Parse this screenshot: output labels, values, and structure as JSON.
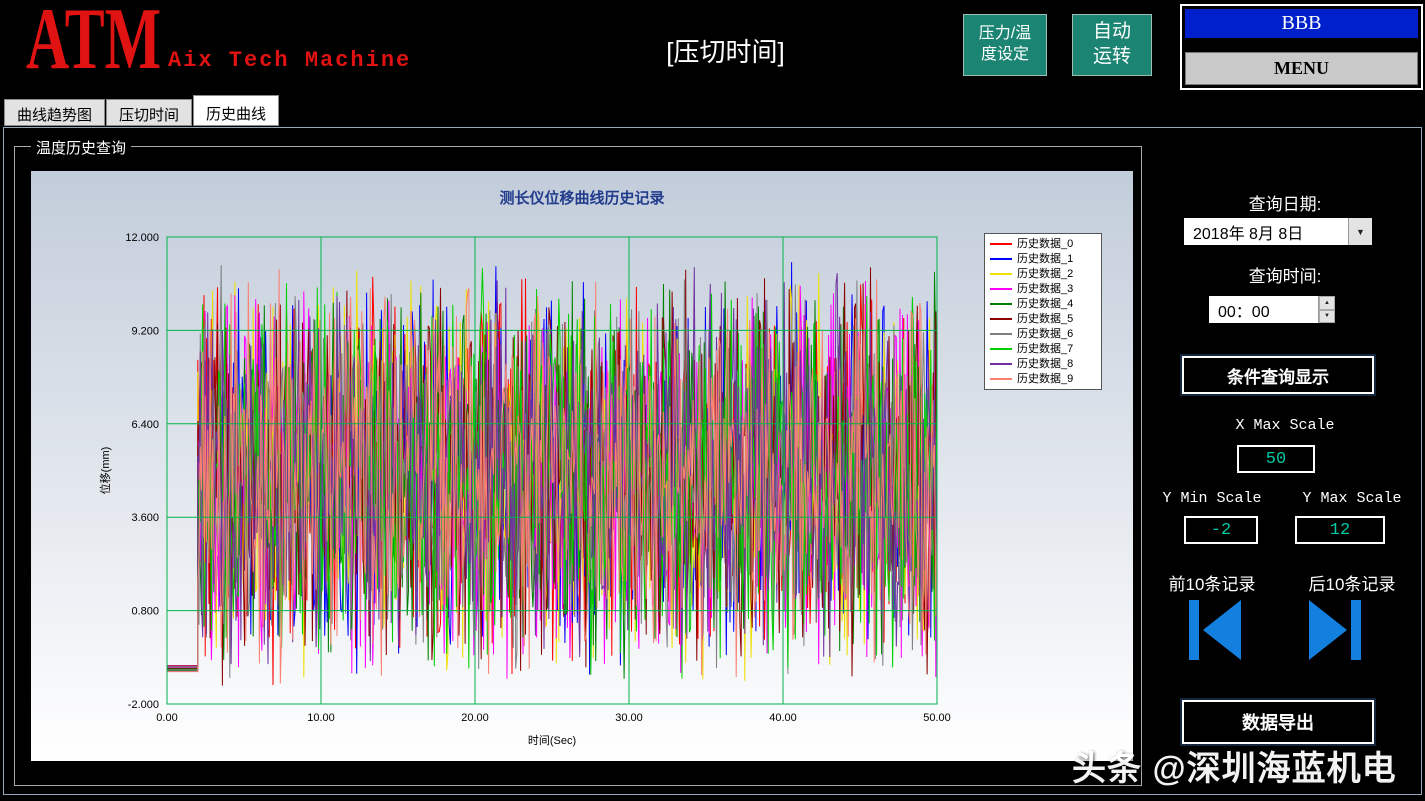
{
  "header": {
    "logo": "ATM",
    "logo_subtitle": "Aix Tech Machine",
    "logo_color": "#E01212",
    "title": "[压切时间]",
    "pressure_temp_button": "压力/温\n度设定",
    "auto_run_button": "自动\n运转",
    "setting_button_color": "#1B8472",
    "bbb_label": "BBB",
    "bbb_bg_color": "#0020CC",
    "menu_button": "MENU"
  },
  "tabs": [
    {
      "label": "曲线趋势图",
      "active": false
    },
    {
      "label": "压切时间",
      "active": false
    },
    {
      "label": "历史曲线",
      "active": true
    }
  ],
  "groupbox_title": "温度历史查询",
  "chart_data": {
    "type": "line",
    "title": "测长仪位移曲线历史记录",
    "title_color": "#223C8C",
    "xlabel": "时间(Sec)",
    "ylabel": "位移(mm)",
    "xlim": [
      0,
      50
    ],
    "ylim": [
      -2,
      12
    ],
    "x_tick_values": [
      0,
      10,
      20,
      30,
      40,
      50
    ],
    "x_tick_labels": [
      "0.00",
      "10.00",
      "20.00",
      "30.00",
      "40.00",
      "50.00"
    ],
    "y_tick_values": [
      12,
      9.2,
      6.4,
      3.6,
      0.8,
      -2
    ],
    "y_tick_labels": [
      "12.000",
      "9.200",
      "6.400",
      "3.600",
      "0.800",
      "-2.000"
    ],
    "grid": true,
    "grid_color": "#00B44B",
    "plot_border_color": "#00B44B",
    "background_gradient": [
      "#C2CCDA",
      "#FFFFFF"
    ],
    "legend_position": "right-top",
    "series": [
      {
        "name": "历史数据_0",
        "color": "#FF0000"
      },
      {
        "name": "历史数据_1",
        "color": "#0000FF"
      },
      {
        "name": "历史数据_2",
        "color": "#F0E000"
      },
      {
        "name": "历史数据_3",
        "color": "#FF00FF"
      },
      {
        "name": "历史数据_4",
        "color": "#008000"
      },
      {
        "name": "历史数据_5",
        "color": "#8B0000"
      },
      {
        "name": "历史数据_6",
        "color": "#808080"
      },
      {
        "name": "历史数据_7",
        "color": "#00D000"
      },
      {
        "name": "历史数据_8",
        "color": "#7030A0"
      },
      {
        "name": "历史数据_9",
        "color": "#FA8072"
      }
    ],
    "signal": {
      "description": "10 overlapping channels of dense high-frequency pseudo-random displacement noise spanning roughly -1.5 to 11.3 mm, preceded by a flat segment near -0.85 mm before t=2s",
      "flat_segment": {
        "x_start": 0,
        "x_end": 2,
        "value": -0.85
      },
      "noise_x_start": 2,
      "noise_x_end": 50,
      "noise_center": 4.9,
      "noise_spread": 6.4,
      "points_per_series": 600,
      "seed": 20180808
    }
  },
  "sidebar": {
    "query_date_label": "查询日期:",
    "date_value": "2018年 8月 8日",
    "query_time_label": "查询时间:",
    "time_value": "00：00",
    "condition_query_button": "条件查询显示",
    "x_max_label": "X Max Scale",
    "x_max_value": "50",
    "y_min_label": "Y Min Scale",
    "y_min_value": "-2",
    "y_max_label": "Y Max Scale",
    "y_max_value": "12",
    "prev_records_label": "前10条记录",
    "next_records_label": "后10条记录",
    "export_button": "数据导出",
    "accent_color": "#1380E0",
    "value_color": "#00C8A2",
    "icons": {
      "dropdown": "▼",
      "up": "▲",
      "down": "▼"
    }
  },
  "watermark": {
    "text": "头条 @深圳海蓝机电"
  }
}
